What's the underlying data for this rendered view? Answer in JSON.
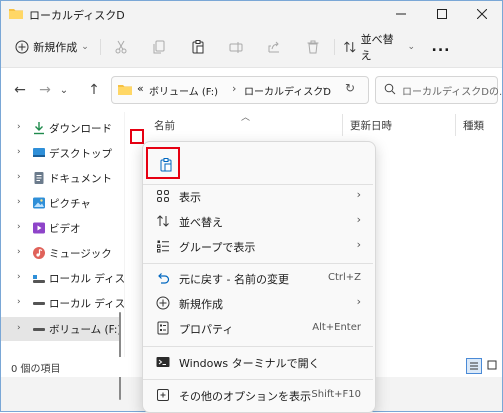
{
  "window": {
    "title": "ローカルディスクD",
    "colors": {
      "accent": "#0067c0",
      "highlight": "#e60012"
    }
  },
  "toolbar": {
    "new_label": "新規作成",
    "sort_label": "並べ替え",
    "more_label": "..."
  },
  "address": {
    "path_prefix": "«",
    "path": [
      "ボリューム (F:)",
      "ローカルディスクD"
    ],
    "separator": "›",
    "search_placeholder": "ローカルディスクDの..."
  },
  "nav_items": [
    {
      "label": "ダウンロード",
      "icon": "download-icon"
    },
    {
      "label": "デスクトップ",
      "icon": "desktop-icon"
    },
    {
      "label": "ドキュメント",
      "icon": "document-icon"
    },
    {
      "label": "ピクチャ",
      "icon": "pictures-icon"
    },
    {
      "label": "ビデオ",
      "icon": "video-icon"
    },
    {
      "label": "ミュージック",
      "icon": "music-icon"
    },
    {
      "label": "ローカル ディスク (",
      "icon": "drive-icon"
    },
    {
      "label": "ローカル ディスク (",
      "icon": "drive-icon"
    },
    {
      "label": "ボリューム (F:)",
      "icon": "drive-icon"
    }
  ],
  "columns": {
    "name": "名前",
    "modified": "更新日時",
    "type": "種類"
  },
  "status": {
    "count": "0 個の項目"
  },
  "context_menu": {
    "items": [
      {
        "label": "表示",
        "icon": "view-icon",
        "submenu": true
      },
      {
        "label": "並べ替え",
        "icon": "sort-icon",
        "submenu": true
      },
      {
        "label": "グループで表示",
        "icon": "group-icon",
        "submenu": true
      },
      {
        "label": "元に戻す - 名前の変更",
        "icon": "undo-icon",
        "shortcut": "Ctrl+Z"
      },
      {
        "label": "新規作成",
        "icon": "new-icon",
        "submenu": true
      },
      {
        "label": "プロパティ",
        "icon": "properties-icon",
        "shortcut": "Alt+Enter"
      },
      {
        "label": "Windows ターミナルで開く",
        "icon": "terminal-icon"
      },
      {
        "label": "その他のオプションを表示",
        "icon": "more-options-icon",
        "shortcut": "Shift+F10"
      }
    ],
    "arrow": "›"
  }
}
